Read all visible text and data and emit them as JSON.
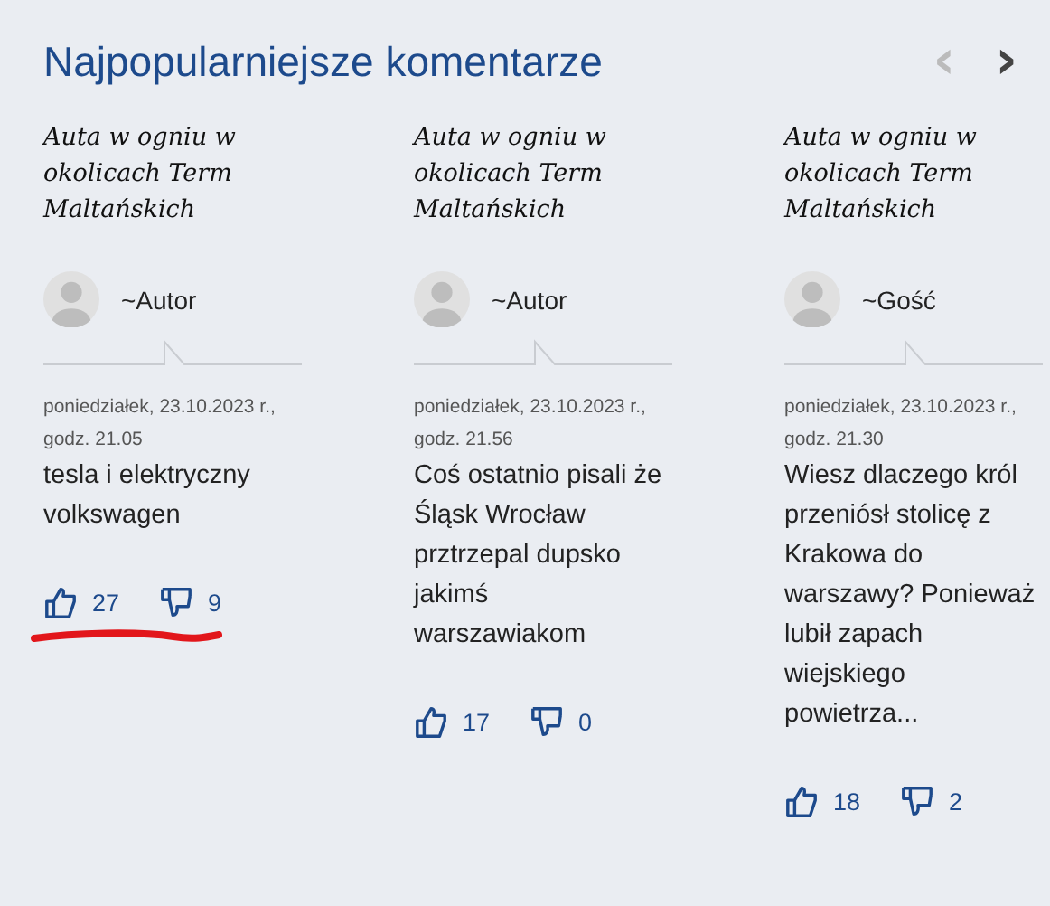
{
  "heading": "Najpopularniejsze komentarze",
  "nav": [
    {
      "symbol": "‹",
      "disabled": true
    },
    {
      "symbol": "›",
      "disabled": false
    }
  ],
  "comments": [
    {
      "article": "Auta w ogniu w okolicach Term Maltańskich",
      "author": "~Autor",
      "date": "poniedziałek, 23.10.2023 r., godz. 21.05",
      "text": "tesla i elektryczny volkswagen",
      "likes": "27",
      "dislikes": "9",
      "underlined": true
    },
    {
      "article": "Auta w ogniu w okolicach Term Maltańskich",
      "author": "~Autor",
      "date": "poniedziałek, 23.10.2023 r., godz. 21.56",
      "text": "Coś ostatnio pisali że Śląsk Wrocław prztrzepal dupsko jakimś warszawiakom",
      "likes": "17",
      "dislikes": "0",
      "underlined": false
    },
    {
      "article": "Auta w ogniu w okolicach Term Maltańskich",
      "author": "~Gość",
      "date": "poniedziałek, 23.10.2023 r., godz. 21.30",
      "text": "Wiesz dlaczego król przeniósł stolicę z Krakowa do warszawy? Ponieważ lubił zapach wiejskiego powietrza...",
      "likes": "18",
      "dislikes": "2",
      "underlined": false
    }
  ]
}
